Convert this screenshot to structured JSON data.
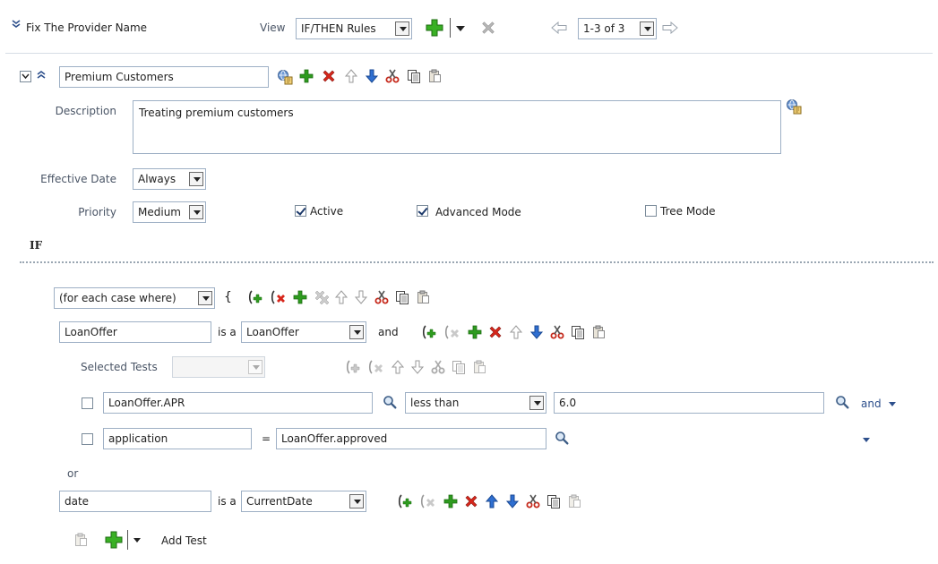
{
  "header": {
    "ruleset_name": "Fix The Provider Name",
    "view_label": "View",
    "view_value": "IF/THEN Rules",
    "pager_value": "1-3 of 3"
  },
  "rule": {
    "name": "Premium Customers",
    "description_label": "Description",
    "description_value": "Treating premium customers",
    "effective_date_label": "Effective Date",
    "effective_date_value": "Always",
    "priority_label": "Priority",
    "priority_value": "Medium",
    "active_label": "Active",
    "active_checked": true,
    "advanced_mode_label": "Advanced Mode",
    "advanced_mode_checked": true,
    "tree_mode_label": "Tree Mode",
    "tree_mode_checked": false
  },
  "if_section": {
    "label": "IF",
    "for_each_value": "(for each case where)",
    "brace": "{",
    "pattern1": {
      "variable": "LoanOffer",
      "is_a": "is a",
      "type": "LoanOffer",
      "conj": "and"
    },
    "selected_tests_label": "Selected Tests",
    "selected_tests_value": "",
    "test1": {
      "left": "LoanOffer.APR",
      "operator": "less than",
      "right": "6.0",
      "conj": "and"
    },
    "test2": {
      "left": "application",
      "operator": "=",
      "right": "LoanOffer.approved"
    },
    "or_label": "or",
    "pattern2": {
      "variable": "date",
      "is_a": "is a",
      "type": "CurrentDate"
    },
    "add_test_label": "Add Test"
  },
  "colors": {
    "add_green": "#2e9b1f",
    "delete_red": "#d7261b",
    "arrow_blue": "#2f6fd1",
    "label_gray": "#4a5566",
    "border_blue": "#9eb0c5"
  },
  "icons": [
    "chevron-double-down-icon",
    "add-icon",
    "dropdown-arrow-icon",
    "delete-icon",
    "arrow-left-icon",
    "arrow-right-icon",
    "collapse-toggle-icon",
    "chevron-double-up-icon",
    "globe-translate-icon",
    "arrow-up-icon",
    "arrow-down-icon",
    "cut-icon",
    "copy-icon",
    "paste-icon",
    "paren-add-icon",
    "paren-delete-icon",
    "search-icon"
  ]
}
